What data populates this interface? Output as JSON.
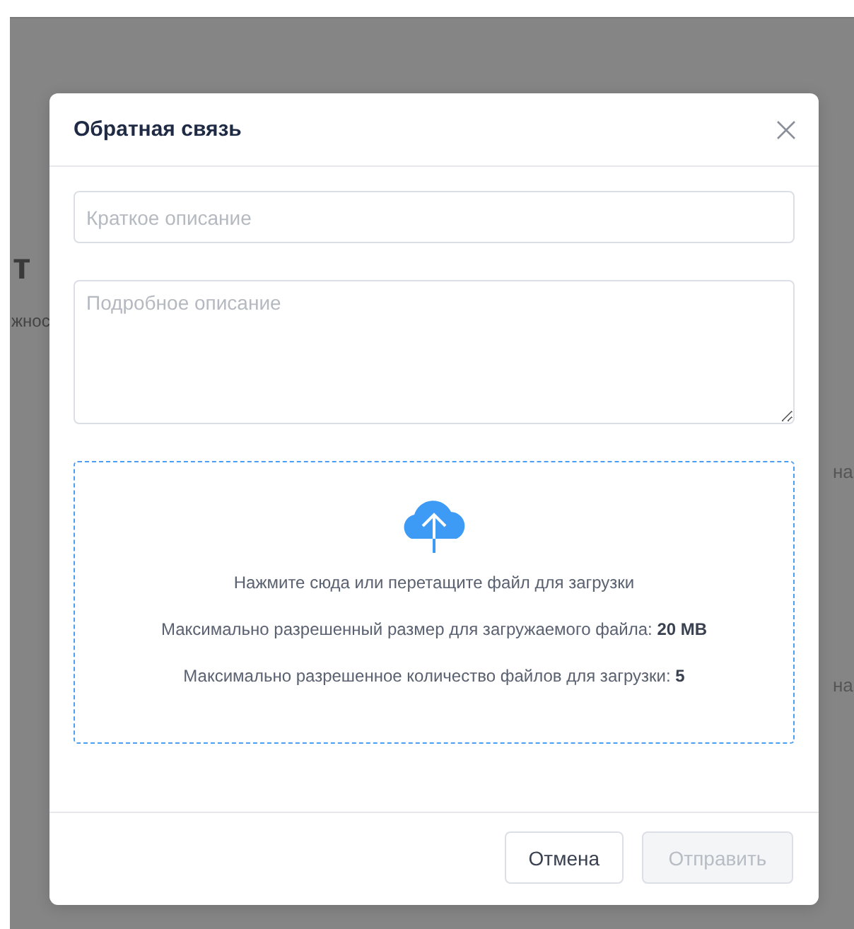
{
  "background": {
    "fragments": [
      {
        "text": "т",
        "kind": "heading"
      },
      {
        "text": "жнос",
        "kind": "sub"
      },
      {
        "text": "на",
        "kind": "right1"
      },
      {
        "text": "на",
        "kind": "right2"
      }
    ]
  },
  "dialog": {
    "title": "Обратная связь",
    "fields": [
      {
        "kind": "input",
        "placeholder": "Краткое описание"
      },
      {
        "kind": "textarea",
        "placeholder": "Подробное описание"
      }
    ],
    "upload": {
      "lines": [
        "Нажмите сюда или перетащите файл для загрузки",
        "Максимально разрешенный размер для загружаемого файла: **20 MB**",
        "Максимально разрешенное количество файлов для загрузки: **5**"
      ]
    },
    "buttons": [
      {
        "label": "Отмена",
        "disabled": false
      },
      {
        "label": "Отправить",
        "disabled": true
      }
    ]
  }
}
